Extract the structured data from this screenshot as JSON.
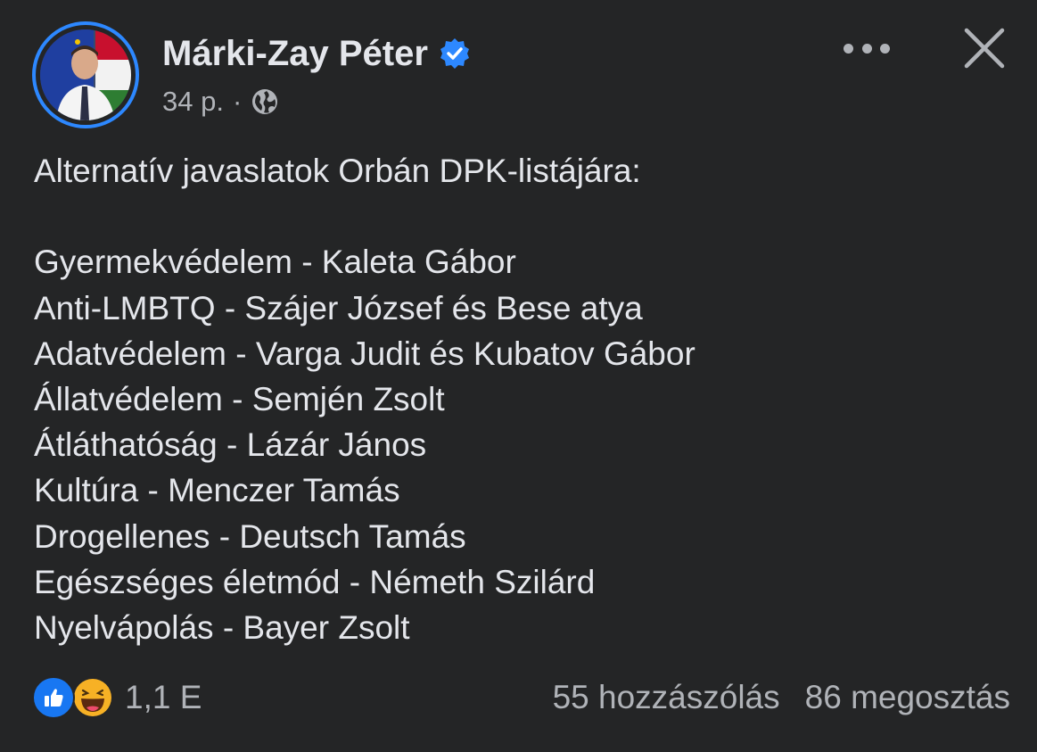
{
  "post": {
    "author": "Márki-Zay Péter",
    "time": "34 p.",
    "separator": "·",
    "audience_icon": "globe-icon",
    "text_lines": [
      "Alternatív javaslatok Orbán DPK-listájára:",
      "",
      "Gyermekvédelem - Kaleta Gábor",
      "Anti-LMBTQ - Szájer József és Bese atya",
      "Adatvédelem - Varga Judit és Kubatov Gábor",
      "Állatvédelem - Semjén Zsolt",
      "Átláthatóság - Lázár János",
      "Kultúra - Menczer Tamás",
      "Drogellenes - Deutsch Tamás",
      "Egészséges életmód - Németh Szilárd",
      "Nyelvápolás - Bayer Zsolt"
    ]
  },
  "footer": {
    "reaction_icons": [
      "like-icon",
      "haha-icon"
    ],
    "reaction_count": "1,1 E",
    "comments": "55 hozzászólás",
    "shares": "86 megosztás"
  },
  "colors": {
    "background": "#242526",
    "text_primary": "#E4E6EB",
    "text_secondary": "#B0B3B8",
    "accent": "#2D88FF",
    "like": "#1877F2"
  }
}
